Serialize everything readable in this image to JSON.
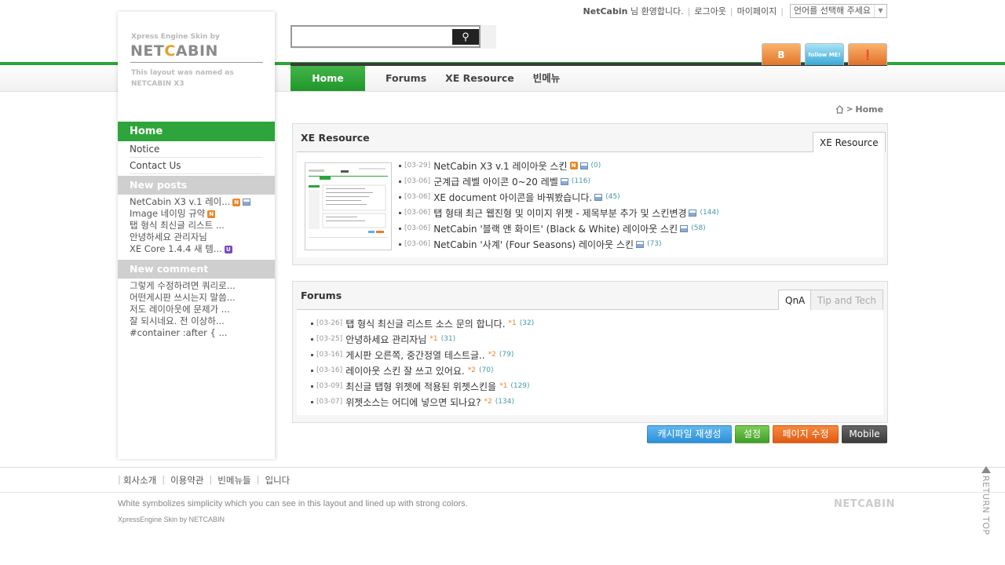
{
  "top": {
    "user": "NetCabin",
    "welcome": "님 환영합니다.",
    "logout": "로그아웃",
    "mypage": "마이페이지",
    "lang_select": "언어를 선택해 주세요"
  },
  "logo": {
    "tagline": "Xpress Engine Skin by",
    "name_a": "NET",
    "name_b": "C",
    "name_c": "ABIN",
    "desc_1": "This layout was named as",
    "desc_2": "NETCABIN X3"
  },
  "search": {
    "placeholder": "",
    "value": ""
  },
  "social": {
    "blog": "B",
    "twitter": "follow ME!",
    "rss": "RSS"
  },
  "gnb": [
    "Home",
    "Forums",
    "XE Resource",
    "빈메뉴"
  ],
  "lnb": {
    "home": "Home",
    "subs": [
      "Notice",
      "Contact Us"
    ],
    "new_posts_title": "New posts",
    "new_posts": [
      {
        "title": "NetCabin X3 v.1 레이...",
        "new": true,
        "file": true
      },
      {
        "title": "Image 네이밍 규약",
        "new": true,
        "file": false
      },
      {
        "title": "탭 형식 최신글 리스트 ...",
        "new": false,
        "file": false
      },
      {
        "title": "안녕하세요 관리자님",
        "new": false,
        "file": false
      },
      {
        "title": "XE Core 1.4.4 새 템...",
        "new": false,
        "file": false,
        "update": true
      }
    ],
    "new_comment_title": "New comment",
    "new_comments": [
      "그렇게 수정하려면 쿼리로...",
      "어떤게시판 쓰시는지 말씀...",
      "저도 레이아웃에 문제가 ...",
      "잘 되시네요. 전 이상하...",
      "#container :after { ..."
    ]
  },
  "breadcrumb": {
    "home_icon": "home-icon",
    "current": "Home"
  },
  "resource": {
    "title": "XE Resource",
    "tab": "XE Resource",
    "items": [
      {
        "date": "[03-29]",
        "title": "NetCabin X3 v.1 레이아웃 스킨",
        "new": true,
        "file": true,
        "count": "(0)"
      },
      {
        "date": "[03-06]",
        "title": "군계급 레벨 아이콘 0~20 레벨",
        "new": false,
        "file": true,
        "count": "(116)"
      },
      {
        "date": "[03-06]",
        "title": "XE document 아이콘을 바꿔봤습니다.",
        "new": false,
        "file": true,
        "count": "(45)"
      },
      {
        "date": "[03-06]",
        "title": "탭 형태 최근 웹진형 및 이미지 위젯 - 제목부분 추가 및 스킨변경",
        "new": false,
        "file": true,
        "count": "(144)"
      },
      {
        "date": "[03-06]",
        "title": "NetCabin '블랙 앤 화이트' (Black & White) 레이아웃 스킨",
        "new": false,
        "file": true,
        "count": "(58)"
      },
      {
        "date": "[03-06]",
        "title": "NetCabin '사계' (Four Seasons) 레이아웃 스킨",
        "new": false,
        "file": true,
        "count": "(73)"
      }
    ]
  },
  "forums": {
    "title": "Forums",
    "tabs": [
      "QnA",
      "Tip and Tech"
    ],
    "items": [
      {
        "date": "[03-26]",
        "title": "탭 형식 최신글 리스트 소스 문의 합니다.",
        "comments": "*1",
        "count": "(32)"
      },
      {
        "date": "[03-25]",
        "title": "안녕하세요 관리자님",
        "comments": "*1",
        "count": "(31)"
      },
      {
        "date": "[03-16]",
        "title": "게시판 오른쪽, 중간정열 테스트글..",
        "comments": "*2",
        "count": "(79)"
      },
      {
        "date": "[03-16]",
        "title": "레이아웃 스킨 잘 쓰고 있어요.",
        "comments": "*2",
        "count": "(70)"
      },
      {
        "date": "[03-09]",
        "title": "최신글 탭형 위젯에 적용된 위젯스킨을",
        "comments": "*1",
        "count": "(129)"
      },
      {
        "date": "[03-07]",
        "title": "위젯소스는 어디에 넣으면 되나요?",
        "comments": "*2",
        "count": "(134)"
      }
    ]
  },
  "buttons": {
    "cache": "캐시파일 재생성",
    "settings": "설정",
    "edit_page": "페이지 수정",
    "mobile": "Mobile"
  },
  "footer": {
    "links": [
      "회사소개",
      "이용약관",
      "빈메뉴들",
      "입니다"
    ],
    "text": "White symbolizes simplicity which you can see in this layout and lined up with strong colors.",
    "small": "XpressEngine Skin by NETCABIN",
    "logo": "NETCABIN",
    "return_top": "RETURN TOP"
  }
}
